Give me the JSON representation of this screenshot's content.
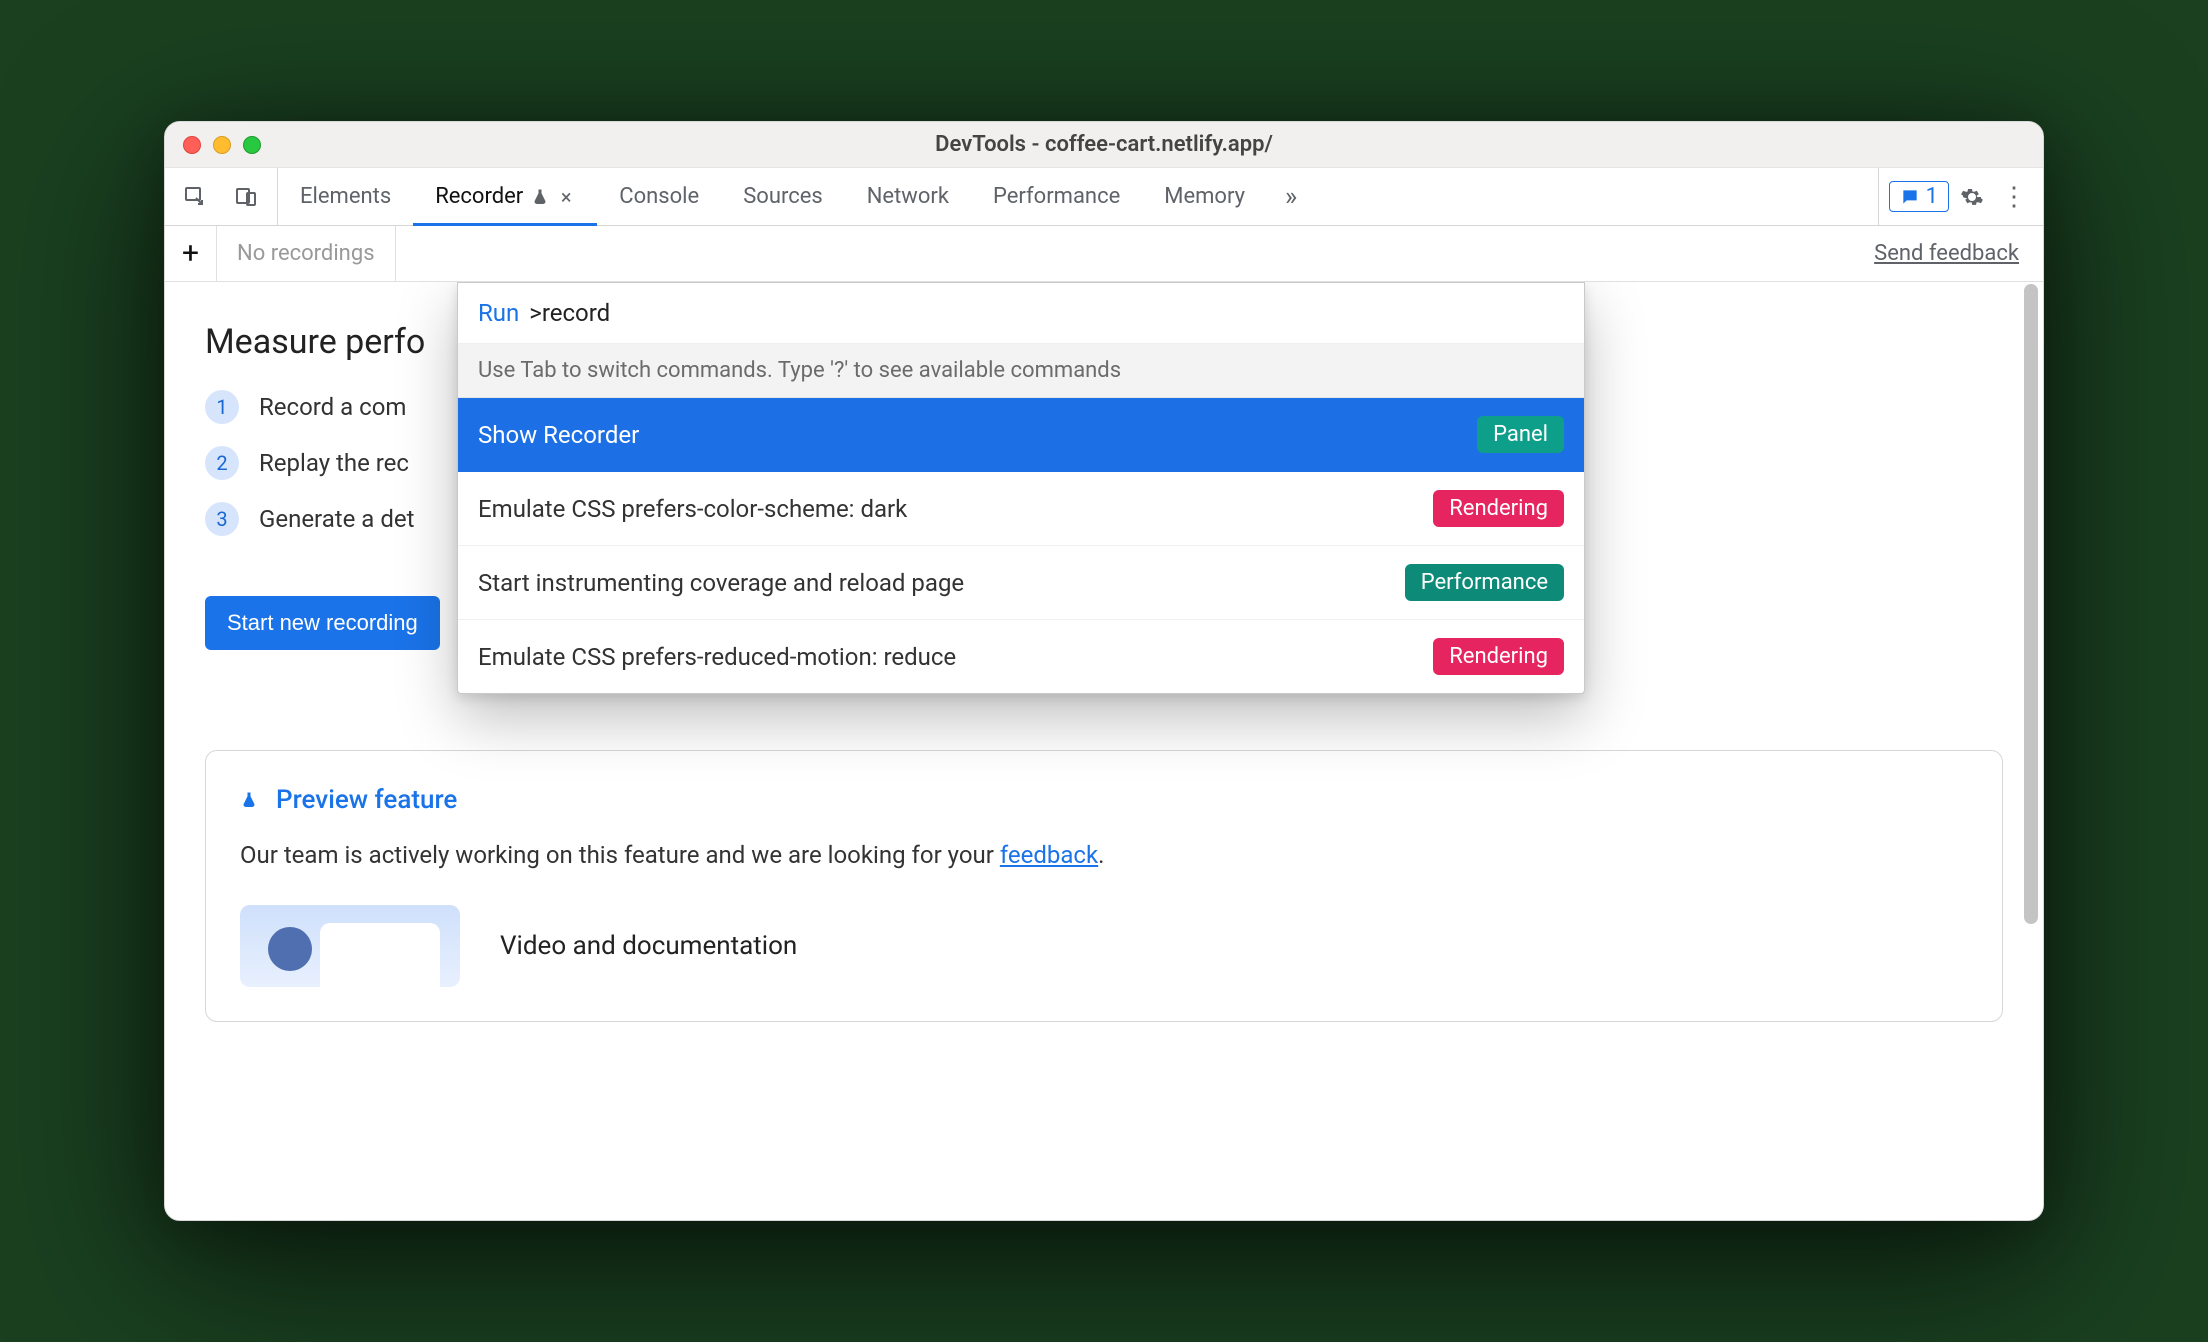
{
  "window": {
    "title": "DevTools - coffee-cart.netlify.app/"
  },
  "toolbar": {
    "tabs": [
      "Elements",
      "Recorder",
      "Console",
      "Sources",
      "Network",
      "Performance",
      "Memory"
    ],
    "active_index": 1,
    "overflow_glyph": "»",
    "message_count": "1"
  },
  "subtoolbar": {
    "no_recordings": "No recordings",
    "send_feedback": "Send feedback"
  },
  "main": {
    "heading": "Measure perfo",
    "steps": [
      {
        "num": "1",
        "text": "Record a com"
      },
      {
        "num": "2",
        "text": "Replay the rec"
      },
      {
        "num": "3",
        "text": "Generate a det"
      }
    ],
    "start_button": "Start new recording"
  },
  "preview": {
    "title": "Preview feature",
    "text_before": "Our team is actively working on this feature and we are looking for your ",
    "link": "feedback",
    "text_after": ".",
    "media_title": "Video and documentation"
  },
  "command_menu": {
    "run_label": "Run",
    "prefix": ">",
    "typed": "record",
    "hint": "Use Tab to switch commands. Type '?' to see available commands",
    "items": [
      {
        "label": "Show Recorder",
        "badge": "Panel",
        "badge_color": "teal",
        "selected": true
      },
      {
        "label": "Emulate CSS prefers-color-scheme: dark",
        "badge": "Rendering",
        "badge_color": "pink",
        "selected": false
      },
      {
        "label": "Start instrumenting coverage and reload page",
        "badge": "Performance",
        "badge_color": "teal2",
        "selected": false
      },
      {
        "label": "Emulate CSS prefers-reduced-motion: reduce",
        "badge": "Rendering",
        "badge_color": "pink",
        "selected": false
      }
    ]
  }
}
